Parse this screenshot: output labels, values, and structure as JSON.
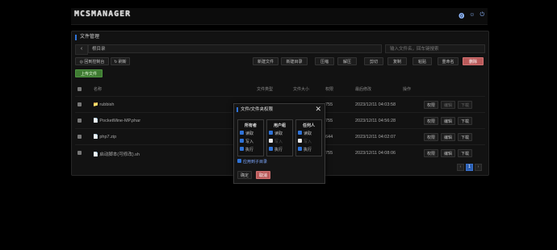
{
  "app": {
    "title": "MCSMANAGER"
  },
  "topbar": {
    "icons": [
      "info-icon",
      "user-icon",
      "power-icon"
    ]
  },
  "panel": {
    "title": "文件管理",
    "back_label": "‹",
    "path": "根目录",
    "search_placeholder": "输入文件名，回车键搜索",
    "toolbar": {
      "back_console": "◎ 回到控制台",
      "refresh": "↻ 刷新",
      "new_file": "新建文件",
      "new_dir": "新建目录",
      "compress": "压缩",
      "decompress": "解压",
      "cut": "剪切",
      "copy": "复制",
      "paste": "粘贴",
      "rename": "重命名",
      "delete": "删除",
      "upload": "上传文件"
    },
    "columns": {
      "name": "名称",
      "type": "文件类型",
      "size": "文件大小",
      "perm": "权限",
      "modified": "最后修改",
      "actions": "操作"
    },
    "rows": [
      {
        "name": "📁 rubbish",
        "perm": "755",
        "modified": "2023/12/11 04:03:58",
        "b1": "权限",
        "b2": "编辑",
        "b3": "下载"
      },
      {
        "name": "📄 PocketMine-MP.phar",
        "perm": "755",
        "modified": "2023/12/11 04:56:28",
        "b1": "权限",
        "b2": "编辑",
        "b3": "下载"
      },
      {
        "name": "📄 php7.zip",
        "perm": "644",
        "modified": "2023/12/11 04:02:07",
        "b1": "权限",
        "b2": "编辑",
        "b3": "下载"
      },
      {
        "name": "📄 启动脚本(可修改).sh",
        "perm": "755",
        "modified": "2023/12/11 04:08:06",
        "b1": "权限",
        "b2": "编辑",
        "b3": "下载"
      }
    ],
    "pager": {
      "prev": "‹",
      "page": "1",
      "next": "›"
    }
  },
  "dialog": {
    "title": "文件/文件夹权限",
    "close": "✕",
    "groups": [
      {
        "title": "所有者",
        "opts": [
          {
            "label": "读取",
            "on": true
          },
          {
            "label": "写入",
            "on": true
          },
          {
            "label": "执行",
            "on": true
          }
        ]
      },
      {
        "title": "用户组",
        "opts": [
          {
            "label": "读取",
            "on": true
          },
          {
            "label": "写入",
            "on": false
          },
          {
            "label": "执行",
            "on": true
          }
        ]
      },
      {
        "title": "任何人",
        "opts": [
          {
            "label": "读取",
            "on": true
          },
          {
            "label": "写入",
            "on": false
          },
          {
            "label": "执行",
            "on": true
          }
        ]
      }
    ],
    "recursive": "应用到子目录",
    "ok": "确定",
    "cancel": "取消"
  }
}
